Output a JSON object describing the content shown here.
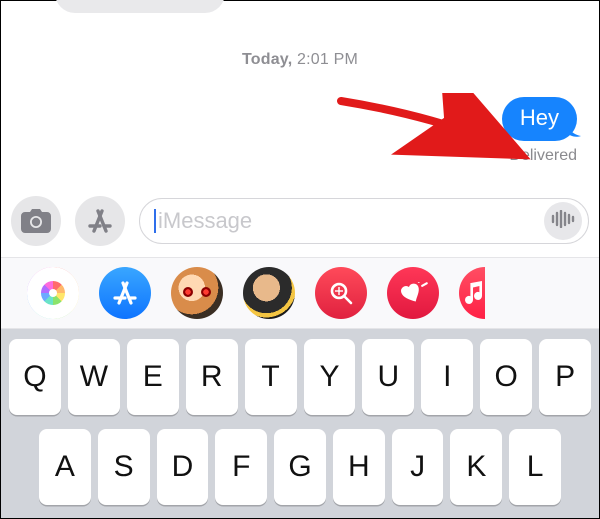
{
  "timestamp": {
    "day": "Today,",
    "time": "2:01 PM"
  },
  "message": {
    "text": "Hey",
    "status": "Delivered"
  },
  "compose": {
    "placeholder": "iMessage",
    "value": ""
  },
  "appstrip": {
    "photos": "photos",
    "appstore": "app-store",
    "memoji1": "memoji",
    "memoji2": "animoji",
    "images": "image-search",
    "digitaltouch": "digital-touch",
    "music": "music"
  },
  "keyboard": {
    "row1": [
      "Q",
      "W",
      "E",
      "R",
      "T",
      "Y",
      "U",
      "I",
      "O",
      "P"
    ],
    "row2": [
      "A",
      "S",
      "D",
      "F",
      "G",
      "H",
      "J",
      "K",
      "L"
    ]
  }
}
